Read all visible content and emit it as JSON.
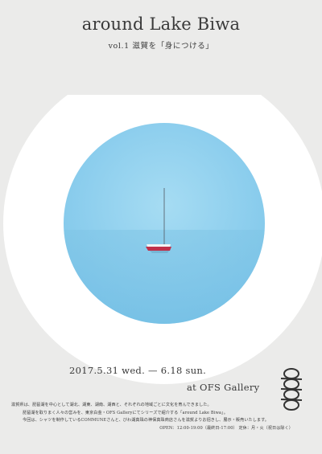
{
  "poster": {
    "title": "around Lake Biwa",
    "subtitle": "vol.1 滋賀を「身につける」",
    "dates": "2017.5.31 wed. — 6.18 sun.",
    "venue": "at OFS Gallery",
    "body": [
      "滋賀県は、琵琶湖を中心として湖北、湖東、湖南、湖西と、それぞれの地域ごとに文化を育んできました。",
      "琵琶湖を取りまく人々の営みを、東京白金・OFS Galleryにてシリーズで紹介する「around Lake Biwa」。",
      "今回は、シャツを制作しているCOMMUNEさんと、びわ湖真珠の神保真珠商店さんを滋賀よりお招きし、展示・販売いたします。",
      "OPEN：12:00-19:00（最終日-17:00） 定休：月・火（祝日は除く）"
    ],
    "colors": {
      "background": "#ebebea",
      "ring": "#ffffff",
      "lake": "#8fd0ee",
      "sail_hull": "#c0304a"
    },
    "icons": {
      "logo": "chain-links-logo",
      "boat": "sailboat-icon"
    }
  }
}
